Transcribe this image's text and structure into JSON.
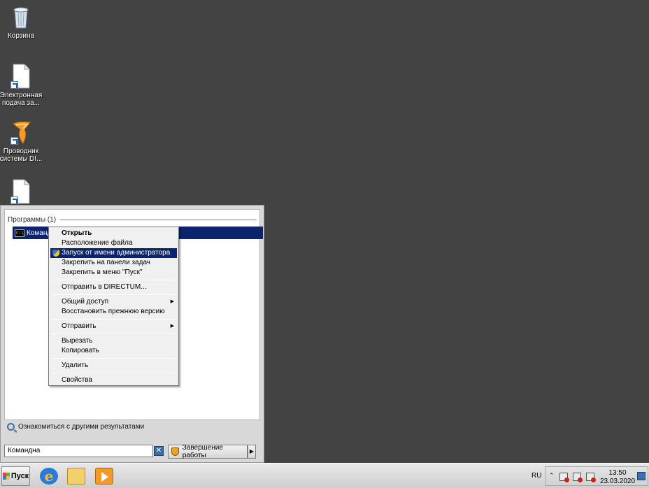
{
  "desktop": {
    "icons": [
      {
        "label": "Корзина",
        "icon": "recycle-bin-icon"
      },
      {
        "label": "Электронная подача за...",
        "icon": "document-shortcut-icon"
      },
      {
        "label": "Проводник системы DI...",
        "icon": "directum-shortcut-icon"
      },
      {
        "label": "",
        "icon": "document-shortcut-icon"
      }
    ]
  },
  "start_menu": {
    "section_header": "Программы (1)",
    "result_item": "Командн",
    "more_results": "Ознакомиться с другими результатами",
    "search_value": "Командна",
    "shutdown_label": "Завершение работы"
  },
  "context_menu": {
    "items": [
      {
        "label": "Открыть"
      },
      {
        "label": "Расположение файла"
      },
      {
        "label": "Запуск от имени администратора"
      },
      {
        "label": "Закрепить на панели задач"
      },
      {
        "label": "Закрепить в меню \"Пуск\""
      },
      {
        "label": "Отправить в DIRECTUM..."
      },
      {
        "label": "Общий доступ"
      },
      {
        "label": "Восстановить прежнюю версию"
      },
      {
        "label": "Отправить"
      },
      {
        "label": "Вырезать"
      },
      {
        "label": "Копировать"
      },
      {
        "label": "Удалить"
      },
      {
        "label": "Свойства"
      }
    ]
  },
  "taskbar": {
    "start_label": "Пуск",
    "language": "RU",
    "time": "13:50",
    "date": "23.03.2020"
  },
  "colors": {
    "desktop": "#434343",
    "selection": "#0b246b"
  }
}
